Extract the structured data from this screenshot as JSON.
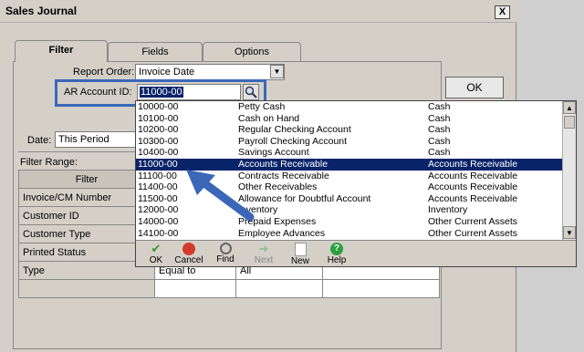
{
  "window": {
    "title": "Sales Journal",
    "close": "X"
  },
  "tabs": [
    "Filter",
    "Fields",
    "Options"
  ],
  "form": {
    "report_order_label": "Report Order:",
    "report_order_value": "Invoice Date",
    "ar_account_label": "AR Account ID:",
    "ar_account_value": "11000-00",
    "date_label": "Date:",
    "date_value": "This Period",
    "filter_range_label": "Filter Range:"
  },
  "ok_label": "OK",
  "grid": {
    "header": "Filter",
    "rows": [
      {
        "name": "Invoice/CM Number",
        "op": "",
        "val": ""
      },
      {
        "name": "Customer ID",
        "op": "",
        "val": ""
      },
      {
        "name": "Customer Type",
        "op": "",
        "val": ""
      },
      {
        "name": "Printed Status",
        "op": "",
        "val": ""
      },
      {
        "name": "Type",
        "op": "Equal to",
        "val": "All"
      },
      {
        "name": "",
        "op": "",
        "val": ""
      }
    ]
  },
  "accounts": [
    {
      "id": "10000-00",
      "desc": "Petty Cash",
      "type": "Cash"
    },
    {
      "id": "10100-00",
      "desc": "Cash on Hand",
      "type": "Cash"
    },
    {
      "id": "10200-00",
      "desc": "Regular Checking Account",
      "type": "Cash"
    },
    {
      "id": "10300-00",
      "desc": "Payroll Checking Account",
      "type": "Cash"
    },
    {
      "id": "10400-00",
      "desc": "Savings Account",
      "type": "Cash"
    },
    {
      "id": "11000-00",
      "desc": "Accounts Receivable",
      "type": "Accounts Receivable"
    },
    {
      "id": "11100-00",
      "desc": "Contracts Receivable",
      "type": "Accounts Receivable"
    },
    {
      "id": "11400-00",
      "desc": "Other Receivables",
      "type": "Accounts Receivable"
    },
    {
      "id": "11500-00",
      "desc": "Allowance for Doubtful Account",
      "type": "Accounts Receivable"
    },
    {
      "id": "12000-00",
      "desc": "Inventory",
      "type": "Inventory"
    },
    {
      "id": "14000-00",
      "desc": "Prepaid Expenses",
      "type": "Other Current Assets"
    },
    {
      "id": "14100-00",
      "desc": "Employee Advances",
      "type": "Other Current Assets"
    }
  ],
  "toolbar": [
    {
      "label": "OK",
      "icon": "check-icon",
      "color": "#2f9a2f"
    },
    {
      "label": "Cancel",
      "icon": "cancel-icon",
      "color": "#d23a2a"
    },
    {
      "label": "Find",
      "icon": "magnifier-icon",
      "color": "#7a7a7a"
    },
    {
      "label": "Next",
      "icon": "next-arrow-icon",
      "color": "#8fbf8f"
    },
    {
      "label": "New",
      "icon": "new-document-icon",
      "color": "#e0b030"
    },
    {
      "label": "Help",
      "icon": "help-icon",
      "color": "#2aa040"
    }
  ],
  "colors": {
    "selection": "#0a246a",
    "callout": "#3a67b8",
    "window": "#d4d0c8"
  }
}
